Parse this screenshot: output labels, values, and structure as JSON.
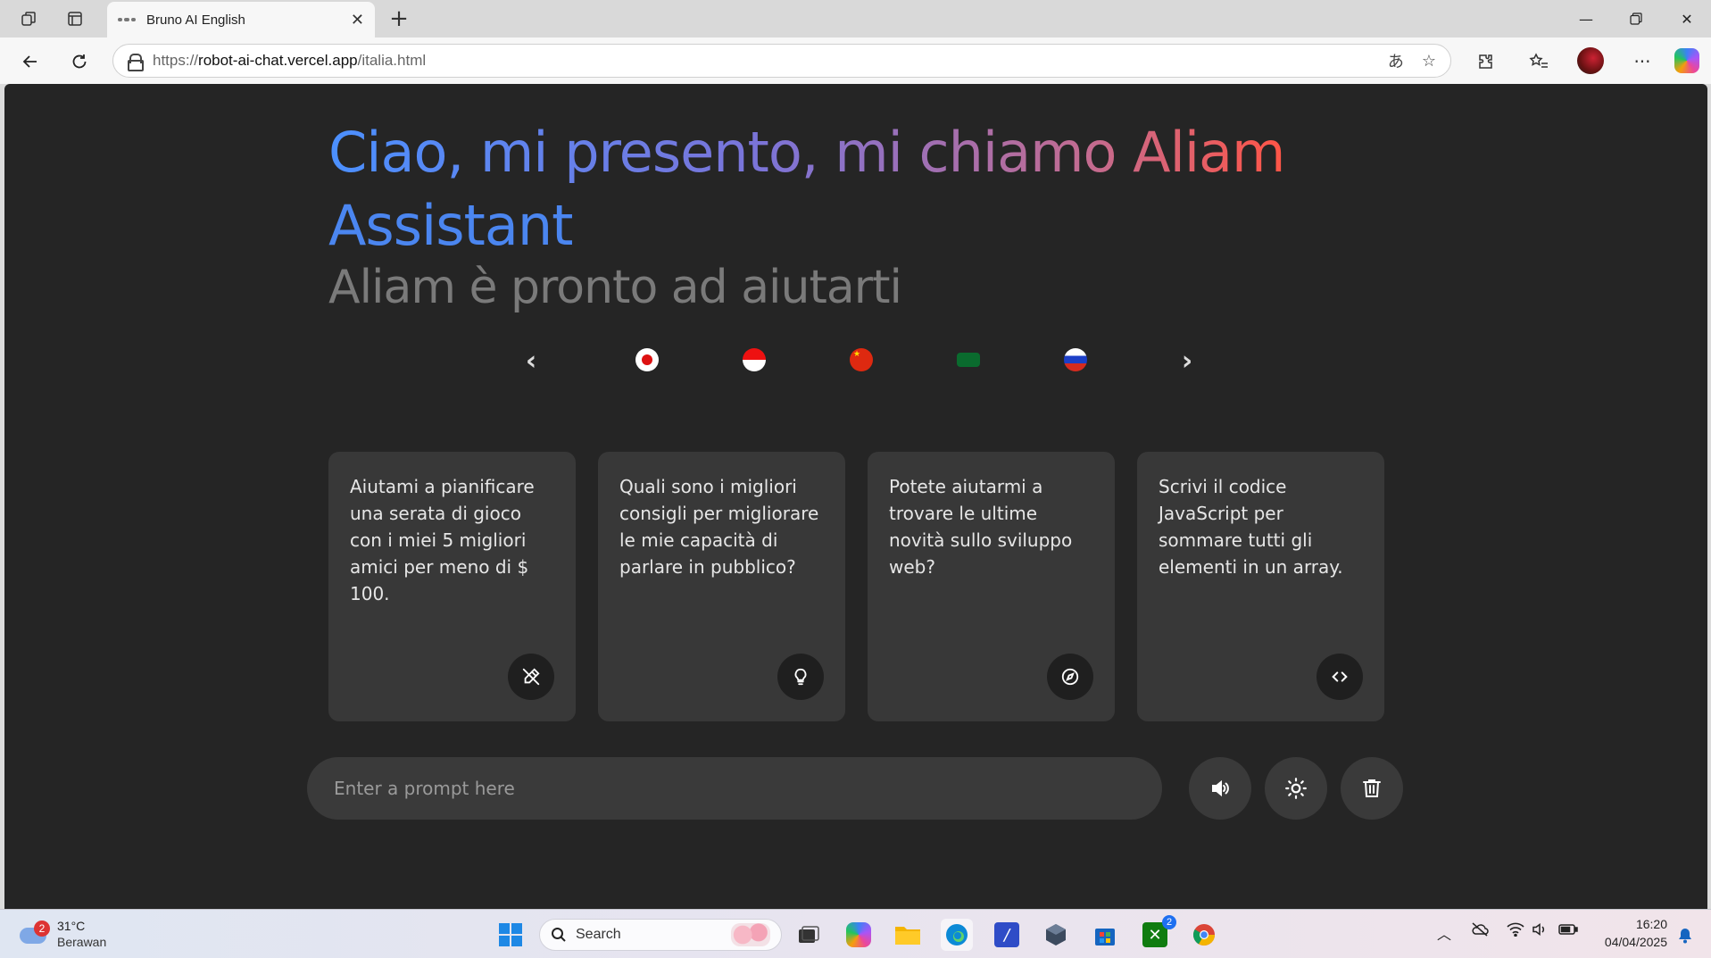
{
  "browser": {
    "tab_title": "Bruno AI English",
    "url_prefix": "https://",
    "url_host": "robot-ai-chat.vercel.app",
    "url_path": "/italia.html"
  },
  "page": {
    "greeting_gradient": "Ciao, mi presento, mi chiamo Aliam",
    "greeting_assistant": "Assistant",
    "subtitle": "Aliam è pronto ad aiutarti",
    "languages": [
      {
        "icon": "japan-flag-icon"
      },
      {
        "icon": "indonesia-flag-icon"
      },
      {
        "icon": "china-flag-icon"
      },
      {
        "icon": "saudi-arabia-flag-icon"
      },
      {
        "icon": "russia-flag-icon"
      }
    ],
    "carousel_prev": "‹",
    "carousel_next": "›",
    "cards": [
      {
        "text": "Aiutami a pianificare una serata di gioco con i miei 5 migliori amici per meno di $ 100.",
        "icon": "pen-off-icon"
      },
      {
        "text": "Quali sono i migliori consigli per migliorare le mie capacità di parlare in pubblico?",
        "icon": "lightbulb-icon"
      },
      {
        "text": "Potete aiutarmi a trovare le ultime novità sullo sviluppo web?",
        "icon": "compass-icon"
      },
      {
        "text": "Scrivi il codice JavaScript per sommare tutti gli elementi in un array.",
        "icon": "code-icon"
      }
    ],
    "prompt_placeholder": "Enter a prompt here",
    "colors": {
      "gradient_start": "#4b90ff",
      "gradient_end": "#ff5546",
      "background": "#252525",
      "card": "#383838"
    }
  },
  "taskbar": {
    "weather_badge": "2",
    "temperature": "31°C",
    "condition": "Berawan",
    "search_label": "Search",
    "time": "16:20",
    "date": "04/04/2025",
    "store_badge": "2"
  }
}
